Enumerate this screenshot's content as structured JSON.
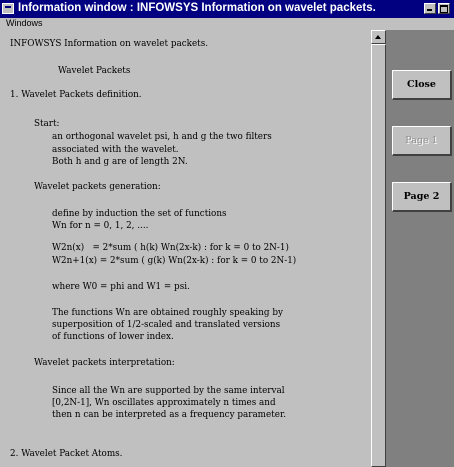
{
  "window": {
    "title": "Information window : INFOWSYS Information on wavelet packets."
  },
  "menubar": {
    "items": [
      {
        "label": "Windows"
      }
    ]
  },
  "document": {
    "lines": [
      "INFOWSYS Information on wavelet packets.",
      "Wavelet Packets",
      "1. Wavelet Packets definition.",
      "Start:",
      "an orthogonal wavelet psi, h and g the two filters",
      "associated with the wavelet.",
      "Both h and g are of length 2N.",
      "Wavelet packets generation:",
      "define by induction the set of functions",
      "Wn for n = 0, 1, 2, ....",
      "W2n(x)   = 2*sum ( h(k) Wn(2x-k) : for k = 0 to 2N-1)",
      "W2n+1(x) = 2*sum ( g(k) Wn(2x-k) : for k = 0 to 2N-1)",
      "where W0 = phi and W1 = psi.",
      "The functions Wn are obtained roughly speaking by",
      "superposition of 1/2-scaled and translated versions",
      "of functions of lower index.",
      "Wavelet packets interpretation:",
      "Since all the Wn are supported by the same interval",
      "[0,2N-1], Wn oscillates approximately n times and",
      "then n can be interpreted as a frequency parameter.",
      "2. Wavelet Packet Atoms."
    ]
  },
  "panel": {
    "close_label": "Close",
    "page1_label": "Page 1",
    "page2_label": "Page 2"
  },
  "colors": {
    "titlebar": "#000080",
    "window_bg": "#c0c0c0",
    "panel_bg": "#808080"
  }
}
